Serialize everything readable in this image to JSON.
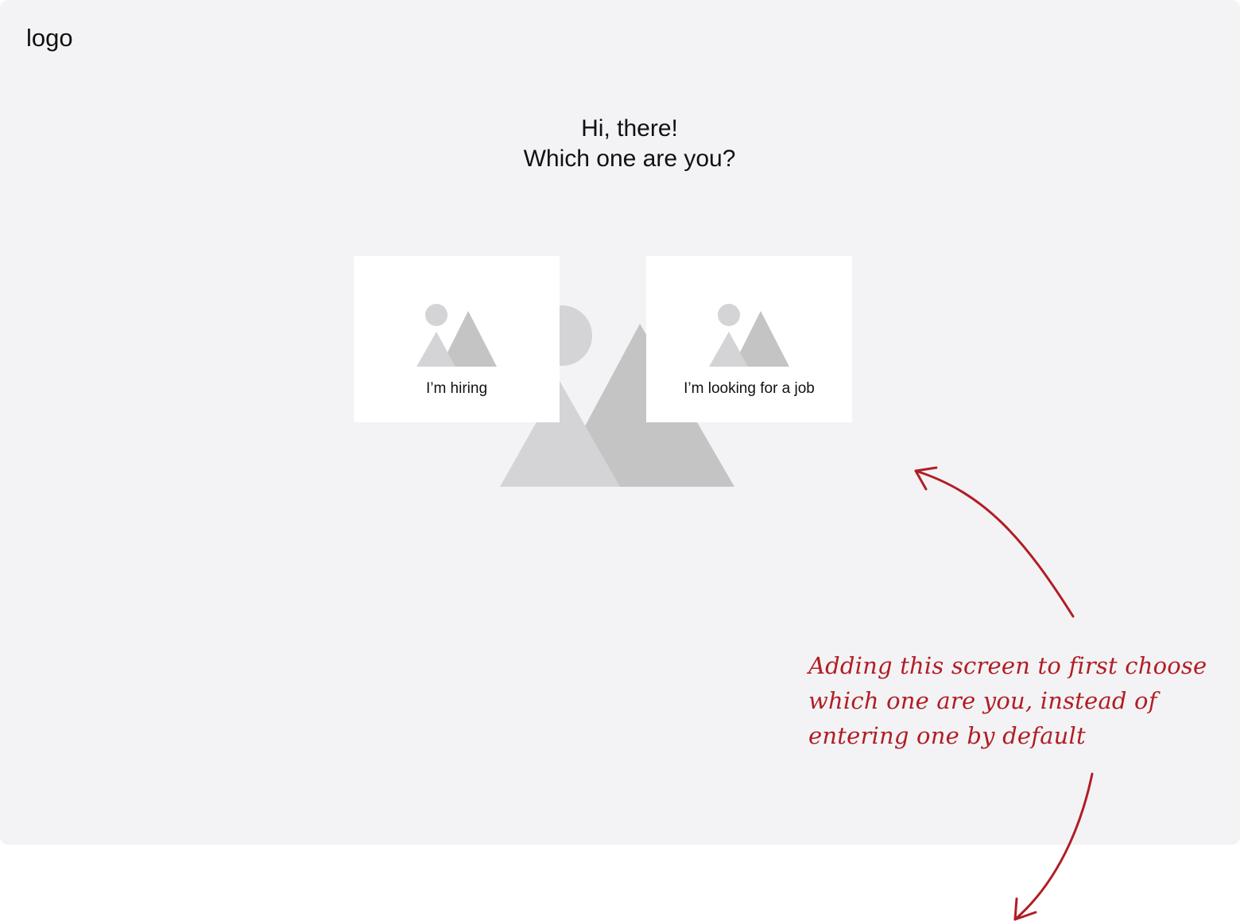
{
  "header": {
    "logo_text": "logo"
  },
  "main": {
    "greeting": "Hi, there!",
    "question": "Which one are you?",
    "options": [
      {
        "label": "I’m hiring",
        "icon": "image-placeholder-icon"
      },
      {
        "label": "I’m looking for a job",
        "icon": "image-placeholder-icon"
      }
    ]
  },
  "annotation": {
    "lines": [
      "Adding this screen to first choose",
      "which one are you, instead of",
      "entering one by default"
    ],
    "color": "#b11d24"
  },
  "colors": {
    "frame_background": "#f3f3f5",
    "card_background": "#ffffff",
    "placeholder_light": "#d4d3d5",
    "placeholder_dark": "#c4c4c4"
  }
}
